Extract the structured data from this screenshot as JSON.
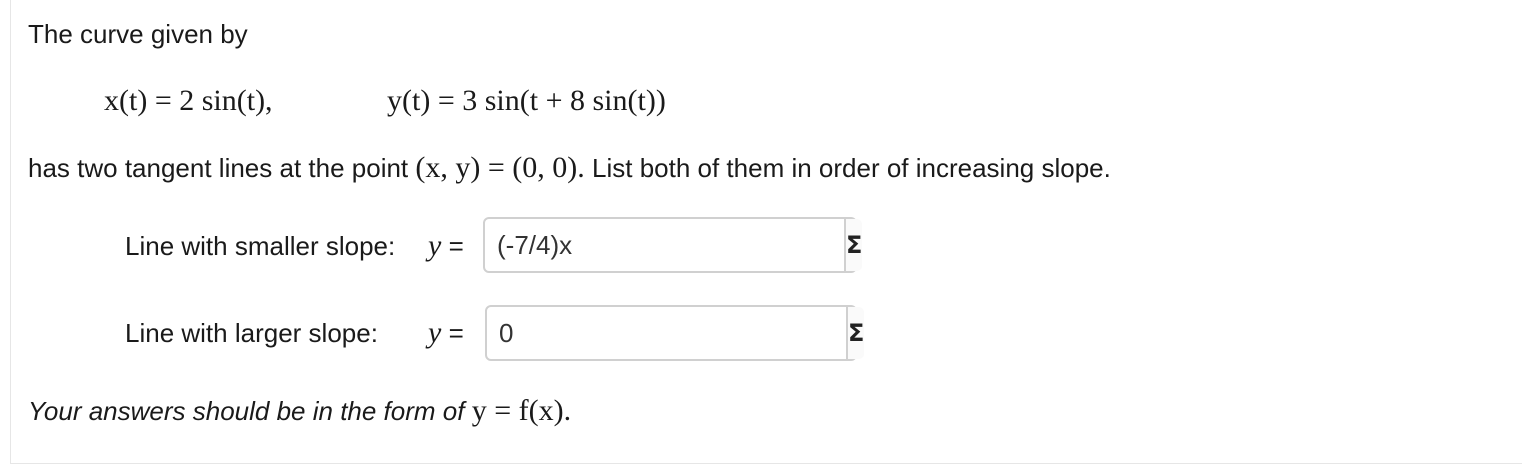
{
  "question": {
    "intro": "The curve given by",
    "eq_x": "x(t) = 2 sin(t),",
    "eq_y": "y(t) = 3 sin(t + 8 sin(t))",
    "statement_before": "has two tangent lines at the point",
    "point_math": "(x, y) = (0, 0).",
    "statement_after": "List both of them in order of increasing slope."
  },
  "answers": {
    "smaller": {
      "label": "Line with smaller slope:",
      "y_label": "y",
      "eq": "=",
      "value": "(-7/4)x",
      "equation_editor_icon": "sigma-icon"
    },
    "larger": {
      "label": "Line with larger slope:",
      "y_label": "y",
      "eq": "=",
      "value": "0",
      "equation_editor_icon": "sigma-icon"
    },
    "sigma_symbol": "Σ"
  },
  "footer": {
    "text": "Your answers should be in the form of",
    "math": "y = f(x)."
  }
}
